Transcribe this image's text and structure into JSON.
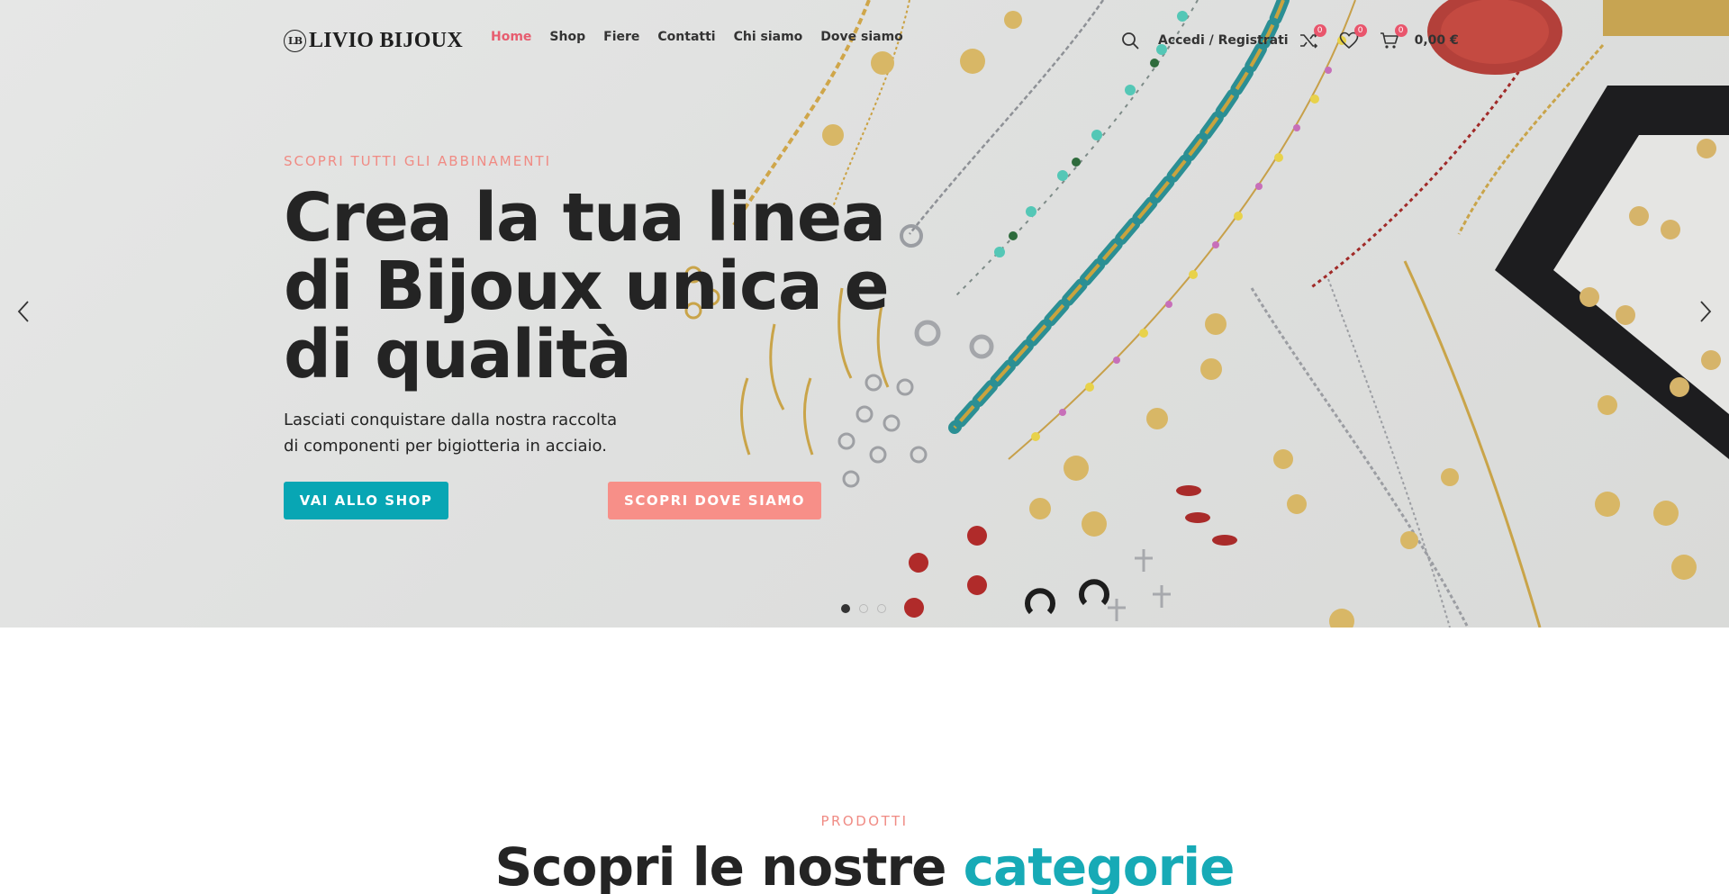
{
  "brand": {
    "mark": "LB",
    "name": "LIVIO BIJOUX"
  },
  "nav": {
    "items": [
      {
        "label": "Home",
        "active": true
      },
      {
        "label": "Shop",
        "active": false
      },
      {
        "label": "Fiere",
        "active": false
      },
      {
        "label": "Contatti",
        "active": false
      },
      {
        "label": "Chi siamo",
        "active": false
      },
      {
        "label": "Dove siamo",
        "active": false
      }
    ]
  },
  "header": {
    "search_icon": "search-icon",
    "account_label": "Accedi / Registrati",
    "compare_count": "0",
    "wishlist_count": "0",
    "cart_count": "0",
    "cart_total": "0,00 €"
  },
  "hero": {
    "eyebrow": "SCOPRI TUTTI GLI ABBINAMENTI",
    "title": "Crea la tua linea\ndi Bijoux unica e\ndi qualità",
    "subtitle": "Lasciati conquistare dalla nostra raccolta\ndi componenti per bigiotteria in acciaio.",
    "primary_button": "VAI ALLO SHOP",
    "secondary_button": "SCOPRI DOVE SIAMO",
    "slides_count": 3,
    "active_slide": 1
  },
  "categories": {
    "eyebrow": "PRODOTTI",
    "title_main": "Scopri le nostre",
    "title_accent": "categorie"
  },
  "colors": {
    "accent_pink": "#e75d6f",
    "teal": "#08a6b4",
    "salmon": "#f78f88",
    "badge": "#e9556c"
  }
}
